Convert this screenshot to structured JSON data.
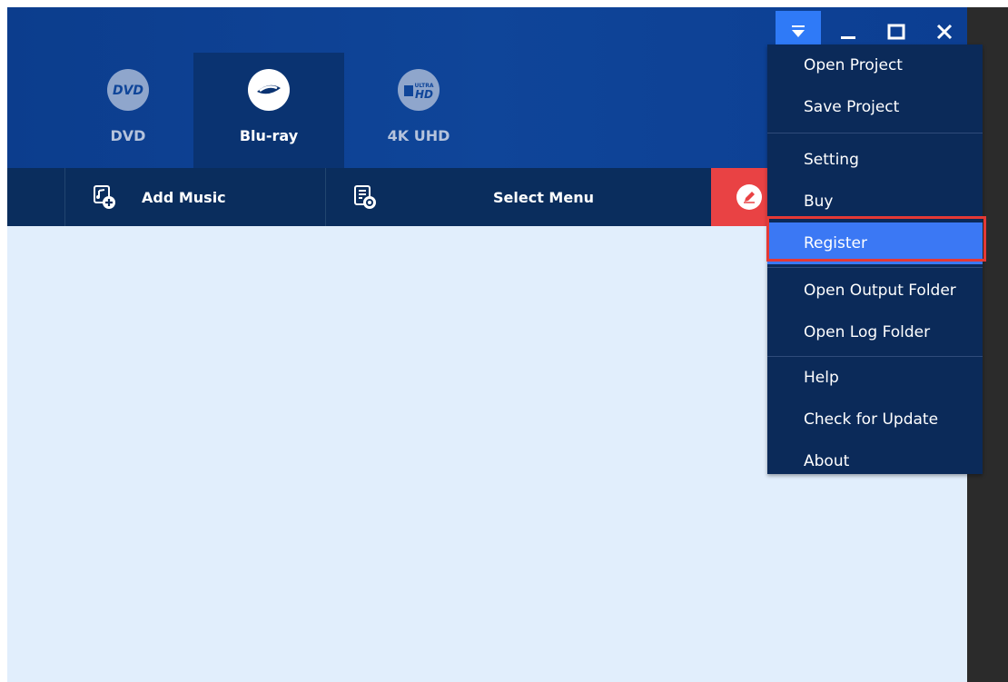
{
  "tabs": [
    {
      "label": "DVD",
      "icon": "dvd-logo-icon",
      "active": false
    },
    {
      "label": "Blu-ray",
      "icon": "bluray-logo-icon",
      "active": true
    },
    {
      "label": "4K UHD",
      "icon": "ultra-hd-logo-icon",
      "active": false
    }
  ],
  "toolbar": {
    "add_music": "Add Music",
    "select_menu": "Select Menu"
  },
  "menu": {
    "items": [
      "Open Project",
      "Save Project",
      "Setting",
      "Buy",
      "Register",
      "Open Output Folder",
      "Open Log Folder",
      "Help",
      "Check for Update",
      "About"
    ],
    "highlighted": "Register"
  },
  "colors": {
    "header": "#0f4599",
    "toolbar": "#0a2d5d",
    "menu_bg": "#0b2a59",
    "menu_highlight": "#3b78f4",
    "edit_button": "#e94244",
    "content_bg": "#e1eefc",
    "outline": "#e53935"
  }
}
